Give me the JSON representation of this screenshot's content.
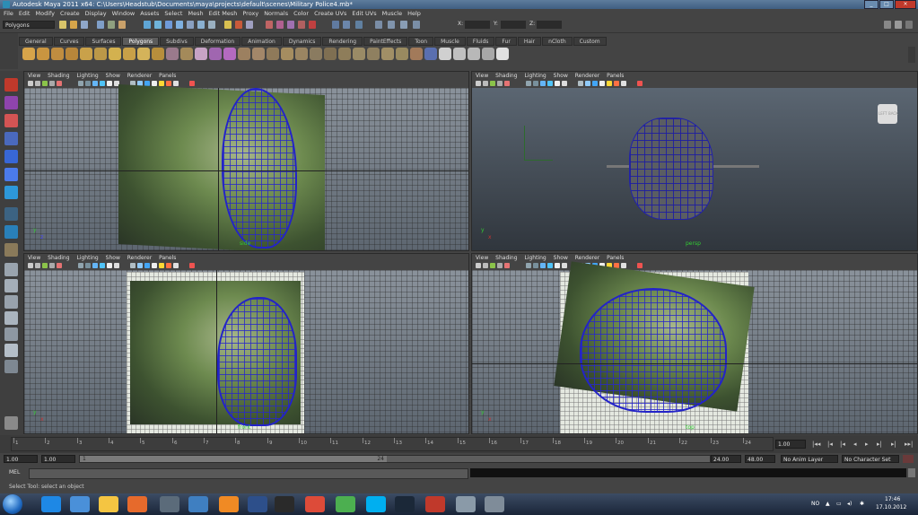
{
  "window": {
    "title": "Autodesk Maya 2011 x64: C:\\Users\\Headstub\\Documents\\maya\\projects\\default\\scenes\\Military Police4.mb*"
  },
  "menubar": [
    "File",
    "Edit",
    "Modify",
    "Create",
    "Display",
    "Window",
    "Assets",
    "Select",
    "Mesh",
    "Edit Mesh",
    "Proxy",
    "Normals",
    "Color",
    "Create UVs",
    "Edit UVs",
    "Muscle",
    "Help"
  ],
  "status_line": {
    "mode": "Polygons",
    "x_label": "X:",
    "y_label": "Y:",
    "z_label": "Z:"
  },
  "shelf_tabs": [
    "General",
    "Curves",
    "Surfaces",
    "Polygons",
    "Subdivs",
    "Deformation",
    "Animation",
    "Dynamics",
    "Rendering",
    "PaintEffects",
    "Toon",
    "Muscle",
    "Fluids",
    "Fur",
    "Hair",
    "nCloth",
    "Custom"
  ],
  "active_shelf_tab": "Polygons",
  "viewport_menu": [
    "View",
    "Shading",
    "Lighting",
    "Show",
    "Renderer",
    "Panels"
  ],
  "viewports": [
    {
      "camera": "side",
      "axis_y": "y",
      "axis_z": "z"
    },
    {
      "camera": "persp",
      "axis_y": "y",
      "axis_z": "x",
      "cube_left": "LEFT",
      "cube_back": "BACK"
    },
    {
      "camera": "front",
      "axis_y": "y",
      "axis_z": "x"
    },
    {
      "camera": "top",
      "axis_y": "y",
      "axis_z": "x"
    }
  ],
  "timeline": {
    "ticks": [
      "1",
      "2",
      "3",
      "4",
      "5",
      "6",
      "7",
      "8",
      "9",
      "10",
      "11",
      "12",
      "13",
      "14",
      "15",
      "16",
      "17",
      "18",
      "19",
      "20",
      "21",
      "22",
      "23",
      "24"
    ],
    "current_frame": "1.00"
  },
  "range": {
    "start": "1.00",
    "start_inner": "1.00",
    "slider_start": "1",
    "slider_end": "24",
    "end_inner": "24.00",
    "end": "48.00",
    "anim_layer": "No Anim Layer",
    "character_set": "No Character Set"
  },
  "command_line": {
    "label": "MEL"
  },
  "help_line": "Select Tool: select an object",
  "taskbar": {
    "lang": "NO",
    "time": "17:46",
    "date": "17.10.2012"
  },
  "colors": {
    "maya_bg": "#444444",
    "viewport_bg": "#6f7882",
    "mesh_blue": "#2323c8",
    "titlebar": "#4b6a8d"
  }
}
